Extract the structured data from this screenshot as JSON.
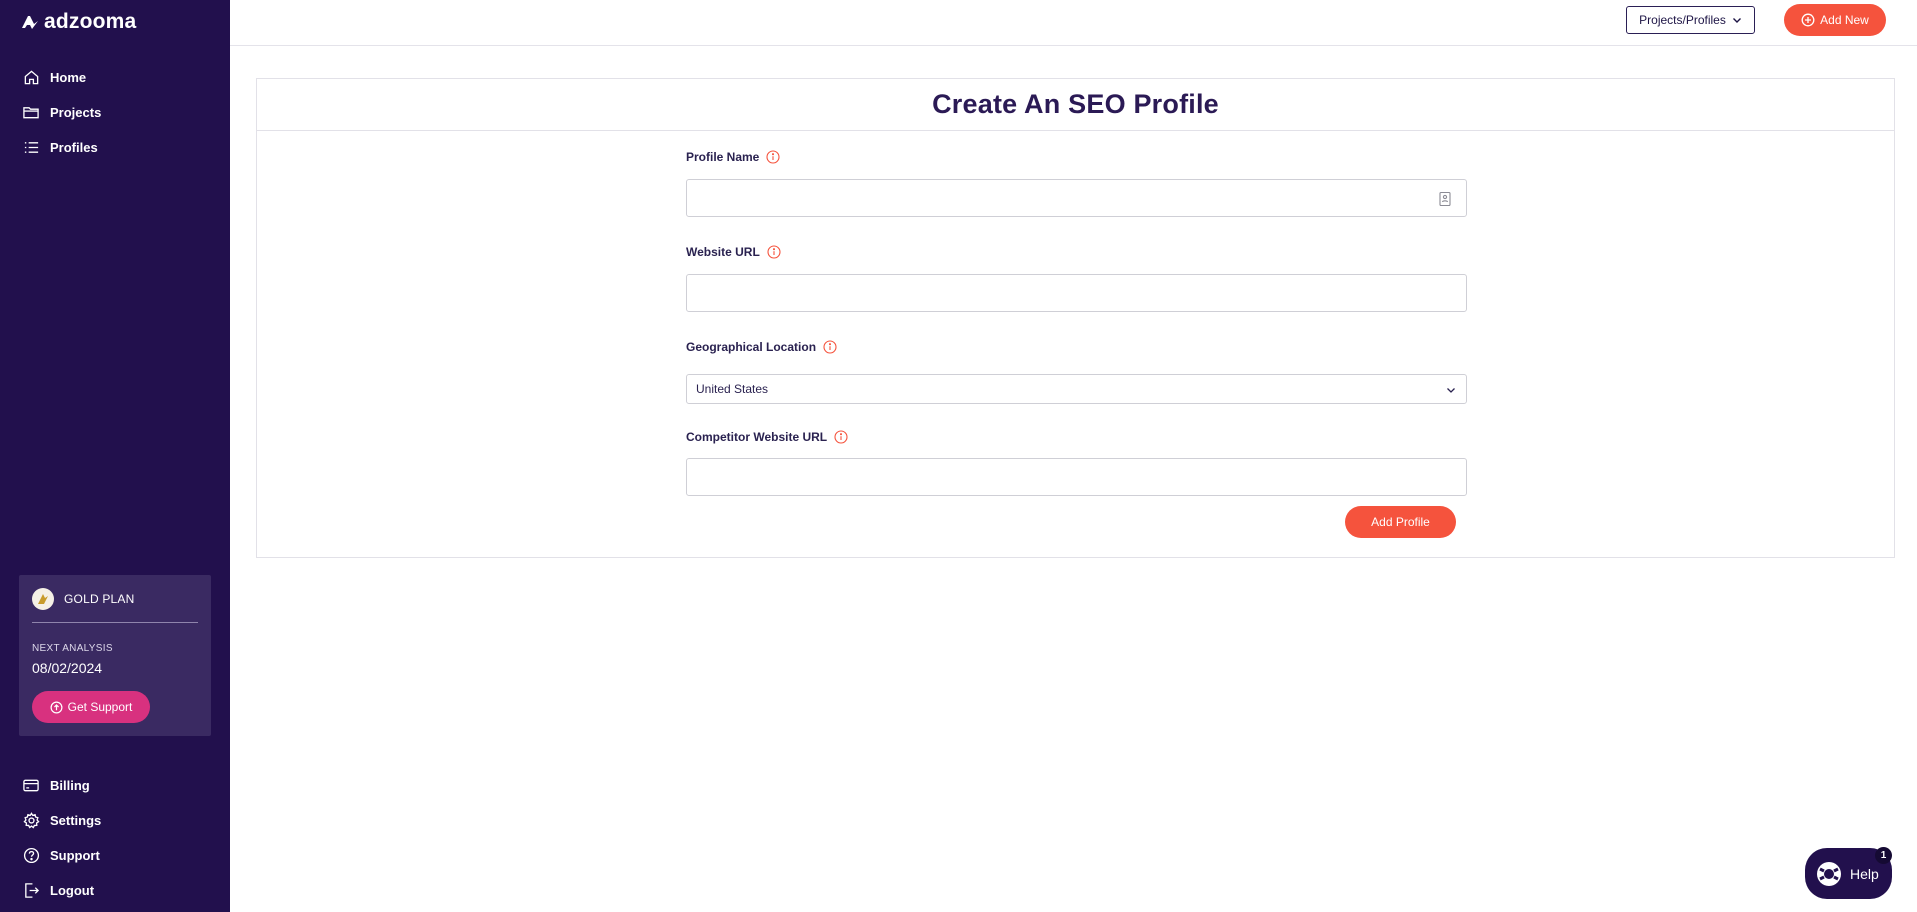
{
  "brand": {
    "name": "adzooma"
  },
  "sidebar": {
    "top_items": [
      {
        "label": "Home",
        "icon": "home-icon"
      },
      {
        "label": "Projects",
        "icon": "folder-icon"
      },
      {
        "label": "Profiles",
        "icon": "list-icon"
      }
    ],
    "plan": {
      "name": "GOLD PLAN",
      "next_label": "NEXT ANALYSIS",
      "next_date": "08/02/2024",
      "support_label": "Get Support"
    },
    "bottom_items": [
      {
        "label": "Billing",
        "icon": "credit-card-icon"
      },
      {
        "label": "Settings",
        "icon": "gear-icon"
      },
      {
        "label": "Support",
        "icon": "help-circle-icon"
      },
      {
        "label": "Logout",
        "icon": "logout-icon"
      }
    ]
  },
  "topbar": {
    "selector_label": "Projects/Profiles",
    "add_new_label": "Add New"
  },
  "form": {
    "title": "Create An SEO Profile",
    "profile_name": {
      "label": "Profile Name",
      "value": ""
    },
    "website_url": {
      "label": "Website URL",
      "value": ""
    },
    "geo_location": {
      "label": "Geographical Location",
      "value": "United States"
    },
    "competitor_url": {
      "label": "Competitor Website URL",
      "value": ""
    },
    "submit_label": "Add Profile"
  },
  "help": {
    "label": "Help",
    "badge": "1"
  },
  "colors": {
    "sidebar_bg": "#22104d",
    "accent": "#f5533d",
    "support_pink": "#d8317f",
    "title": "#2b1a55"
  }
}
